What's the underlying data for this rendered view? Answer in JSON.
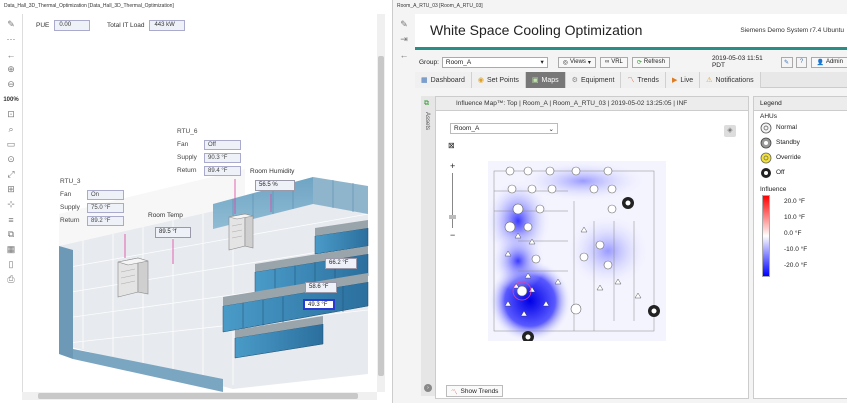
{
  "left_pane": {
    "title": "Data_Hall_3D_Thermal_Optimization [Data_Hall_3D_Thermal_Optimization]",
    "toolbar": [
      {
        "icon": "pen-icon"
      },
      {
        "icon": "dots-icon"
      },
      {
        "icon": "back-arrow-icon"
      },
      {
        "icon": "zoom-in-icon"
      },
      {
        "icon": "zoom-out-icon"
      },
      {
        "label": "100%"
      },
      {
        "icon": "fit-icon"
      },
      {
        "icon": "search-icon"
      },
      {
        "icon": "frame-icon"
      },
      {
        "icon": "zoom-area-icon"
      },
      {
        "icon": "expand-icon"
      },
      {
        "icon": "network-icon"
      },
      {
        "icon": "snap-icon"
      },
      {
        "icon": "lines-icon"
      },
      {
        "icon": "layers-icon"
      },
      {
        "icon": "grid-icon"
      },
      {
        "icon": "page-icon"
      },
      {
        "icon": "print-icon"
      }
    ],
    "pue": {
      "label": "PUE",
      "value": "0.00"
    },
    "total_it": {
      "label": "Total IT Load",
      "value": "443 kW"
    },
    "rtu6": {
      "title": "RTU_6",
      "fan_label": "Fan",
      "fan": "Off",
      "supply_label": "Supply",
      "supply": "90.3 °F",
      "return_label": "Return",
      "return": "89.4 °F"
    },
    "rtu3": {
      "title": "RTU_3",
      "fan_label": "Fan",
      "fan": "On",
      "supply_label": "Supply",
      "supply": "75.0 °F",
      "return_label": "Return",
      "return": "89.2 °F"
    },
    "humidity": {
      "label": "Room Humidity",
      "value": "56.5 %"
    },
    "room_temp": {
      "label": "Room Temp",
      "value": "89.5 °f"
    },
    "rack_temps": [
      "66.2 °F",
      "58.6 °F",
      "49.3 °F"
    ]
  },
  "right_pane": {
    "title": "Room_A_RTU_03 [Room_A_RTU_03]",
    "app_title": "White Space Cooling Optimization",
    "system": "Siemens Demo System r7.4 Ubuntu",
    "group_label": "Group:",
    "group_value": "Room_A",
    "views_label": "Views",
    "vrl_label": "VRL",
    "refresh_label": "Refresh",
    "datetime": "2019-05-03 11:51 PDT",
    "admin_label": "Admin",
    "tabs": [
      {
        "label": "Dashboard",
        "icon": "dashboard-icon"
      },
      {
        "label": "Set Points",
        "icon": "setpoints-icon"
      },
      {
        "label": "Maps",
        "icon": "maps-icon",
        "active": true
      },
      {
        "label": "Equipment",
        "icon": "equipment-icon"
      },
      {
        "label": "Trends",
        "icon": "trends-icon"
      },
      {
        "label": "Live",
        "icon": "live-icon"
      },
      {
        "label": "Notifications",
        "icon": "notifications-icon"
      }
    ],
    "assets_label": "Assets",
    "map_header": "Influence Map™: Top | Room_A | Room_A_RTU_03 | 2019-05-02 13:25:05 | INF",
    "map_room": "Room_A",
    "show_trends": "Show Trends",
    "legend": {
      "title": "Legend",
      "ahus_label": "AHUs",
      "items": [
        "Normal",
        "Standby",
        "Override",
        "Off"
      ],
      "influence_label": "Influence",
      "scale": [
        {
          "value": "20.0 °F",
          "color": "#ff0000"
        },
        {
          "value": "10.0 °F",
          "color": "#ff9a9a"
        },
        {
          "value": "0.0 °F",
          "color": "#ffffff"
        },
        {
          "value": "-10.0 °F",
          "color": "#9a9aff"
        },
        {
          "value": "-20.0 °F",
          "color": "#0000ff"
        }
      ]
    }
  }
}
